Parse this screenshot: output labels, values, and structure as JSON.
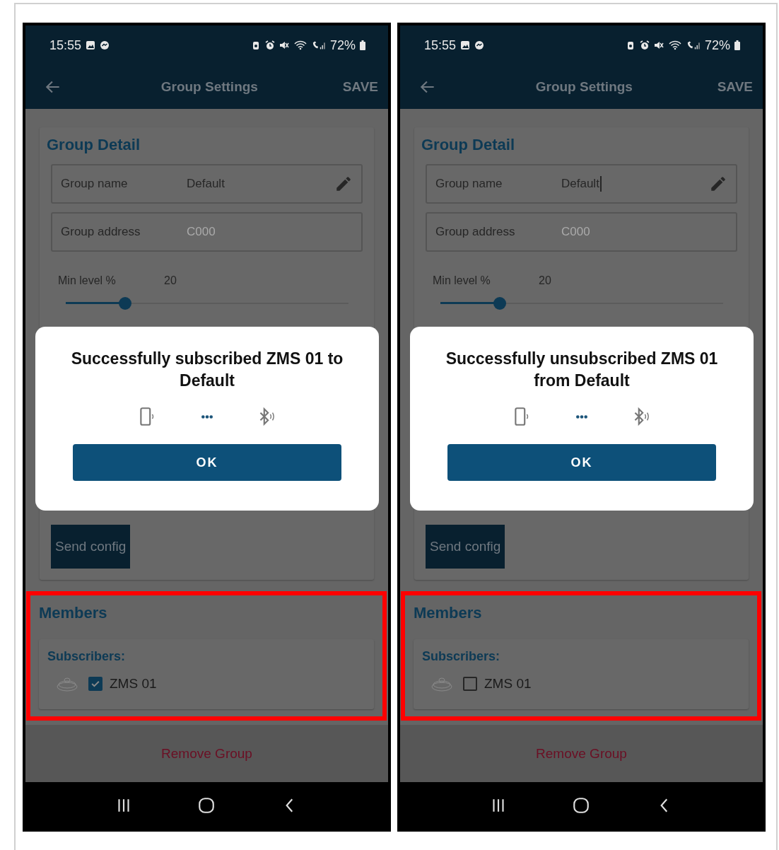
{
  "phones": [
    {
      "status_bar": {
        "time": "15:55",
        "battery": "72%"
      },
      "app_bar": {
        "title": "Group Settings",
        "action": "SAVE"
      },
      "group_detail": {
        "title": "Group Detail",
        "fields": [
          {
            "label": "Group name",
            "value": "Default",
            "kind": "editable",
            "focused": false
          },
          {
            "label": "Group address",
            "value": "C000",
            "kind": "readonly",
            "focused": false
          }
        ],
        "min_level": {
          "label": "Min level %",
          "value": "20",
          "level": 0.2
        },
        "send_button": "Send config"
      },
      "dialog": {
        "message": "Successfully subscribed ZMS 01 to Default",
        "button": "OK"
      },
      "members": {
        "title": "Members",
        "highlighted": true,
        "subscribers_label": "Subscribers:",
        "items": [
          {
            "name": "ZMS 01",
            "checked": true
          }
        ]
      },
      "remove_button": "Remove Group"
    },
    {
      "status_bar": {
        "time": "15:55",
        "battery": "72%"
      },
      "app_bar": {
        "title": "Group Settings",
        "action": "SAVE"
      },
      "group_detail": {
        "title": "Group Detail",
        "fields": [
          {
            "label": "Group name",
            "value": "Default",
            "kind": "editable",
            "focused": true
          },
          {
            "label": "Group address",
            "value": "C000",
            "kind": "readonly",
            "focused": false
          }
        ],
        "min_level": {
          "label": "Min level %",
          "value": "20",
          "level": 0.2
        },
        "send_button": "Send config"
      },
      "dialog": {
        "message": "Successfully unsubscribed ZMS 01 from Default",
        "button": "OK"
      },
      "members": {
        "title": "Members",
        "highlighted": true,
        "subscribers_label": "Subscribers:",
        "items": [
          {
            "name": "ZMS 01",
            "checked": false
          }
        ]
      },
      "remove_button": "Remove Group"
    }
  ]
}
